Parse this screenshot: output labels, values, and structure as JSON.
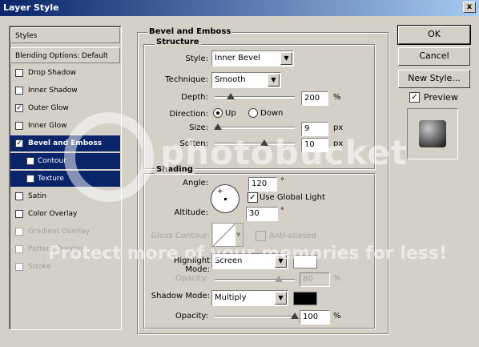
{
  "window": {
    "title": "Layer Style",
    "close": "x"
  },
  "left_panel": {
    "items": [
      {
        "label": "Styles",
        "checked": null,
        "state": "button"
      },
      {
        "label": "Blending Options: Default",
        "checked": null,
        "state": "button"
      },
      {
        "label": "Drop Shadow",
        "checked": "",
        "state": "normal"
      },
      {
        "label": "Inner Shadow",
        "checked": "",
        "state": "normal"
      },
      {
        "label": "Outer Glow",
        "checked": "✓",
        "state": "normal"
      },
      {
        "label": "Inner Glow",
        "checked": "",
        "state": "normal"
      },
      {
        "label": "Bevel and Emboss",
        "checked": "✓",
        "state": "selected"
      },
      {
        "label": "Contour",
        "checked": "",
        "state": "sub"
      },
      {
        "label": "Texture",
        "checked": "",
        "state": "sub"
      },
      {
        "label": "Satin",
        "checked": "",
        "state": "normal"
      },
      {
        "label": "Color Overlay",
        "checked": "",
        "state": "normal"
      },
      {
        "label": "Gradient Overlay",
        "checked": "",
        "state": "disabled"
      },
      {
        "label": "Pattern Overlay",
        "checked": "",
        "state": "disabled"
      },
      {
        "label": "Stroke",
        "checked": "",
        "state": "disabled"
      }
    ]
  },
  "bevel": {
    "title": "Bevel and Emboss",
    "structure": {
      "title": "Structure",
      "style_label": "Style:",
      "style_value": "Inner Bevel",
      "technique_label": "Technique:",
      "technique_value": "Smooth",
      "depth_label": "Depth:",
      "depth_value": "200",
      "depth_unit": "%",
      "depth_fraction": 0.2,
      "direction_label": "Direction:",
      "dir_up": "Up",
      "dir_down": "Down",
      "size_label": "Size:",
      "size_value": "9",
      "size_unit": "px",
      "size_fraction": 0.04,
      "soften_label": "Soften:",
      "soften_value": "10",
      "soften_unit": "px",
      "soften_fraction": 0.62
    },
    "shading": {
      "title": "Shading",
      "angle_label": "Angle:",
      "angle_value": "120",
      "angle_unit": "°",
      "use_global_light": "Use Global Light",
      "use_global_light_checked": "✓",
      "altitude_label": "Altitude:",
      "altitude_value": "30",
      "altitude_unit": "°",
      "gloss_label": "Gloss Contour:",
      "anti_aliased": "Anti-aliased",
      "highlight_label": "Highlight Mode:",
      "highlight_value": "Screen",
      "highlight_color": "#ffffff",
      "hl_opacity_label": "Opacity:",
      "hl_opacity_value": "80",
      "hl_opacity_unit": "%",
      "hl_opacity_fraction": 0.8,
      "shadow_label": "Shadow Mode:",
      "shadow_value": "Multiply",
      "shadow_color": "#000000",
      "sh_opacity_label": "Opacity:",
      "sh_opacity_value": "100",
      "sh_opacity_unit": "%",
      "sh_opacity_fraction": 1.0
    }
  },
  "buttons": {
    "ok": "OK",
    "cancel": "Cancel",
    "new_style": "New Style...",
    "preview": "Preview",
    "preview_checked": "✓"
  },
  "watermark": {
    "text": "photobucket",
    "tagline": "Protect more of your memories for less!"
  }
}
